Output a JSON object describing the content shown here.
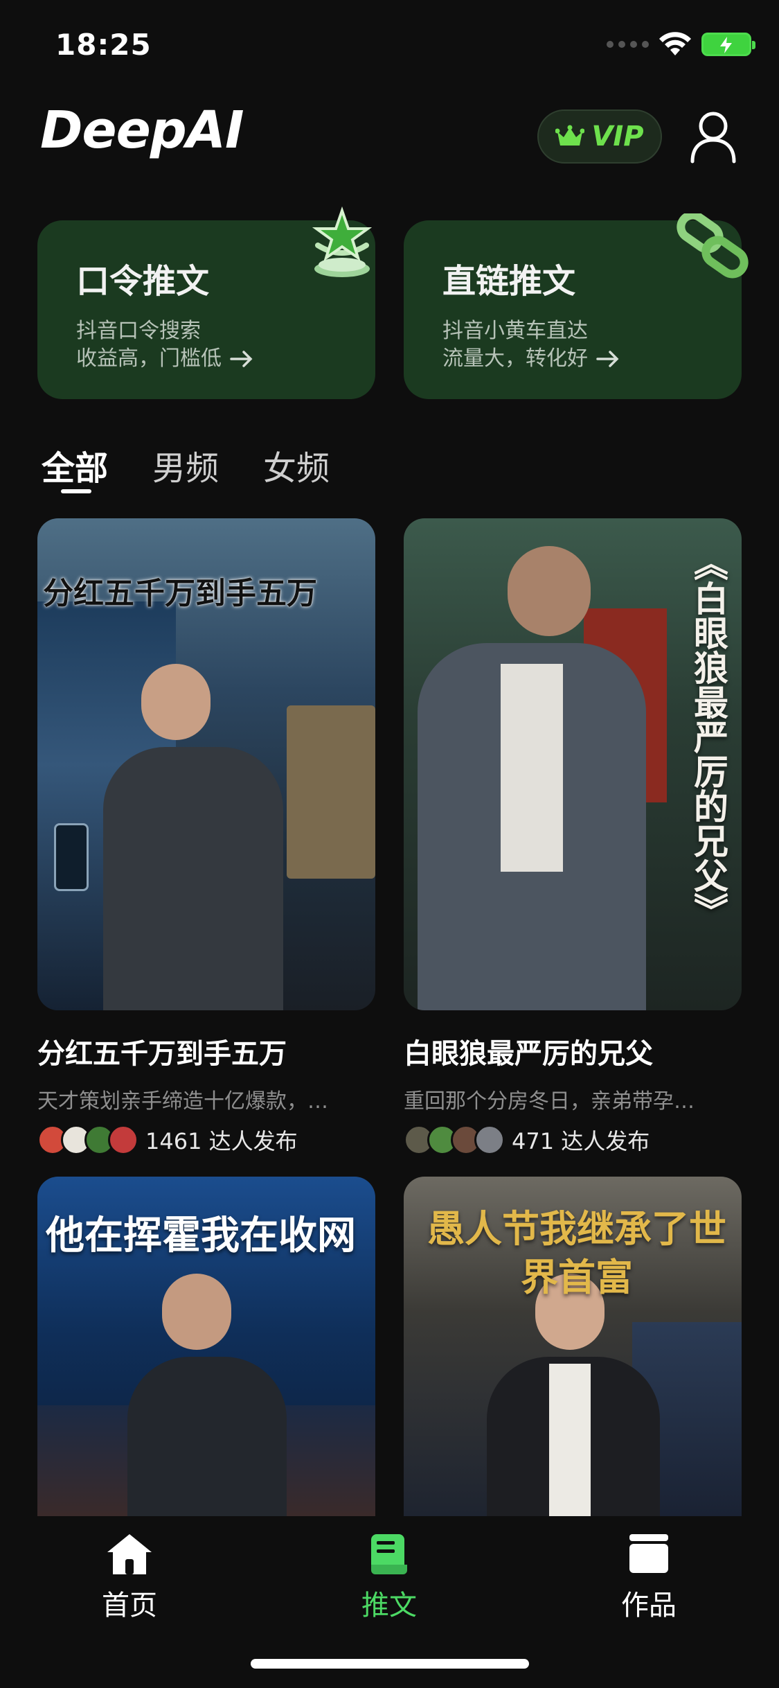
{
  "status_bar": {
    "time": "18:25"
  },
  "header": {
    "app_name": "DeepAI",
    "vip_label": "VIP"
  },
  "promos": [
    {
      "title": "口令推文",
      "line1": "抖音口令搜索",
      "line2": "收益高，门槛低"
    },
    {
      "title": "直链推文",
      "line1": "抖音小黄车直达",
      "line2": "流量大，转化好"
    }
  ],
  "tabs": [
    {
      "label": "全部",
      "active": true
    },
    {
      "label": "男频",
      "active": false
    },
    {
      "label": "女频",
      "active": false
    }
  ],
  "cards": [
    {
      "cover_text": "分红五千万到手五万",
      "title": "分红五千万到手五万",
      "desc": "天才策划亲手缔造十亿爆款，…",
      "count": "1461 达人发布"
    },
    {
      "cover_text": "《白眼狼最严厉的兄父》",
      "title": "白眼狼最严厉的兄父",
      "desc": "重回那个分房冬日，亲弟带孕…",
      "count": "471 达人发布"
    },
    {
      "cover_text": "他在挥霍我在收网",
      "title": "",
      "desc": "",
      "count": ""
    },
    {
      "cover_text": "愚人节我继承了世界首富",
      "title": "",
      "desc": "",
      "count": ""
    }
  ],
  "bottom_nav": [
    {
      "label": "首页",
      "icon": "home-icon",
      "active": false
    },
    {
      "label": "推文",
      "icon": "scroll-icon",
      "active": true
    },
    {
      "label": "作品",
      "icon": "works-icon",
      "active": false
    }
  ],
  "colors": {
    "accent": "#4cd964",
    "promo_bg": "#1b3a20",
    "background": "#0e0e0e"
  }
}
